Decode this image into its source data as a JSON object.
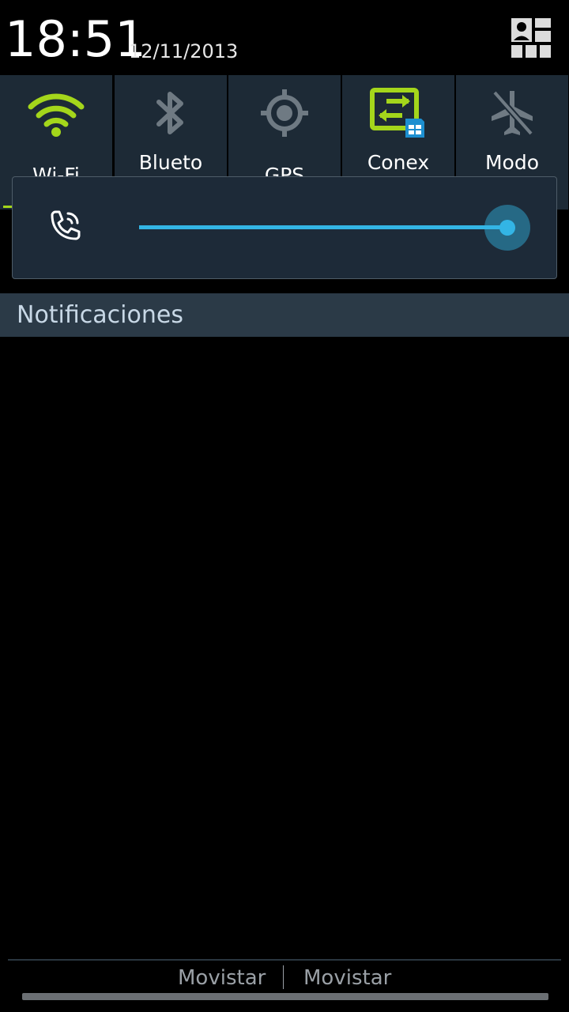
{
  "status": {
    "time": "18:51",
    "date": "12/11/2013"
  },
  "quick_settings": [
    {
      "label": "Wi-Fi",
      "icon": "wifi-icon",
      "active": true
    },
    {
      "label": "Blueto",
      "icon": "bluetooth-icon",
      "active": false
    },
    {
      "label": "GPS",
      "icon": "gps-icon",
      "active": false
    },
    {
      "label": "Conex",
      "icon": "data-connection-icon",
      "active": true
    },
    {
      "label": "Modo",
      "icon": "airplane-icon",
      "active": false
    }
  ],
  "volume": {
    "icon": "phone-ring-icon",
    "level": 0.97
  },
  "notifications": {
    "title": "Notificaciones"
  },
  "carriers": [
    "Movistar",
    "Movistar"
  ],
  "colors": {
    "active_green": "#a4d61b",
    "accent_blue": "#33b5e5",
    "inactive_grey": "#6f7a83",
    "tile_bg": "#1d2a36"
  }
}
